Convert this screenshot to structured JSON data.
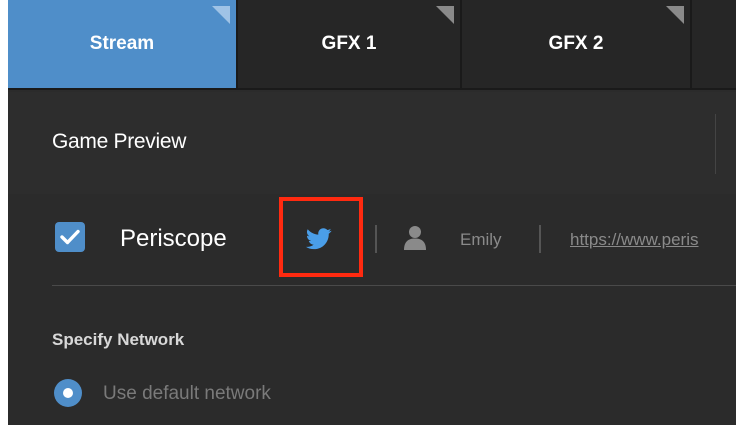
{
  "tabs": [
    {
      "label": "Stream",
      "active": true
    },
    {
      "label": "GFX 1",
      "active": false
    },
    {
      "label": "GFX 2",
      "active": false
    },
    {
      "label": "",
      "active": false
    }
  ],
  "preview": {
    "title": "Game Preview"
  },
  "stream_target": {
    "checked": true,
    "service": "Periscope",
    "social_icon": "twitter-icon",
    "account_icon": "user-icon",
    "username": "Emily",
    "url": "https://www.peris"
  },
  "network": {
    "label": "Specify Network",
    "option": "Use default network",
    "selected": true
  },
  "colors": {
    "accent": "#4f8ec9",
    "highlight": "#ff2a10",
    "twitter": "#4a9ee8"
  }
}
